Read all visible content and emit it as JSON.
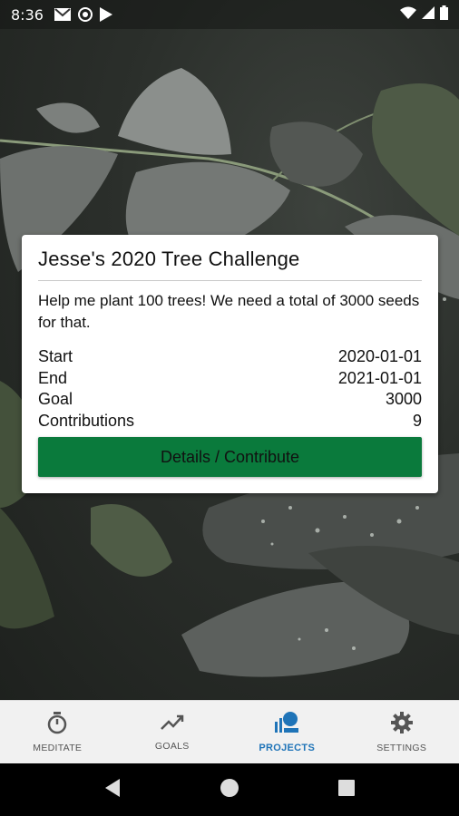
{
  "status_bar": {
    "time": "8:36",
    "icons": [
      "gmail-icon",
      "vpn-icon",
      "play-store-icon"
    ],
    "right_icons": [
      "wifi-icon",
      "signal-icon",
      "battery-icon"
    ]
  },
  "project_card": {
    "title": "Jesse's 2020 Tree Challenge",
    "description": "Help me plant 100 trees! We need a total of 3000 seeds for that.",
    "rows": [
      {
        "label": "Start",
        "value": "2020-01-01"
      },
      {
        "label": "End",
        "value": "2021-01-01"
      },
      {
        "label": "Goal",
        "value": "3000"
      },
      {
        "label": "Contributions",
        "value": "9"
      }
    ],
    "button_label": "Details / Contribute",
    "button_color": "#0a7a3c"
  },
  "bottom_nav": {
    "items": [
      {
        "label": "MEDITATE",
        "icon": "stopwatch-icon"
      },
      {
        "label": "GOALS",
        "icon": "trending-up-icon"
      },
      {
        "label": "PROJECTS",
        "icon": "projects-icon",
        "active": true
      },
      {
        "label": "SETTINGS",
        "icon": "gear-icon"
      }
    ],
    "active_color": "#1f74b8"
  },
  "system_nav": {
    "icons": [
      "back-icon",
      "home-icon",
      "recents-icon"
    ]
  }
}
